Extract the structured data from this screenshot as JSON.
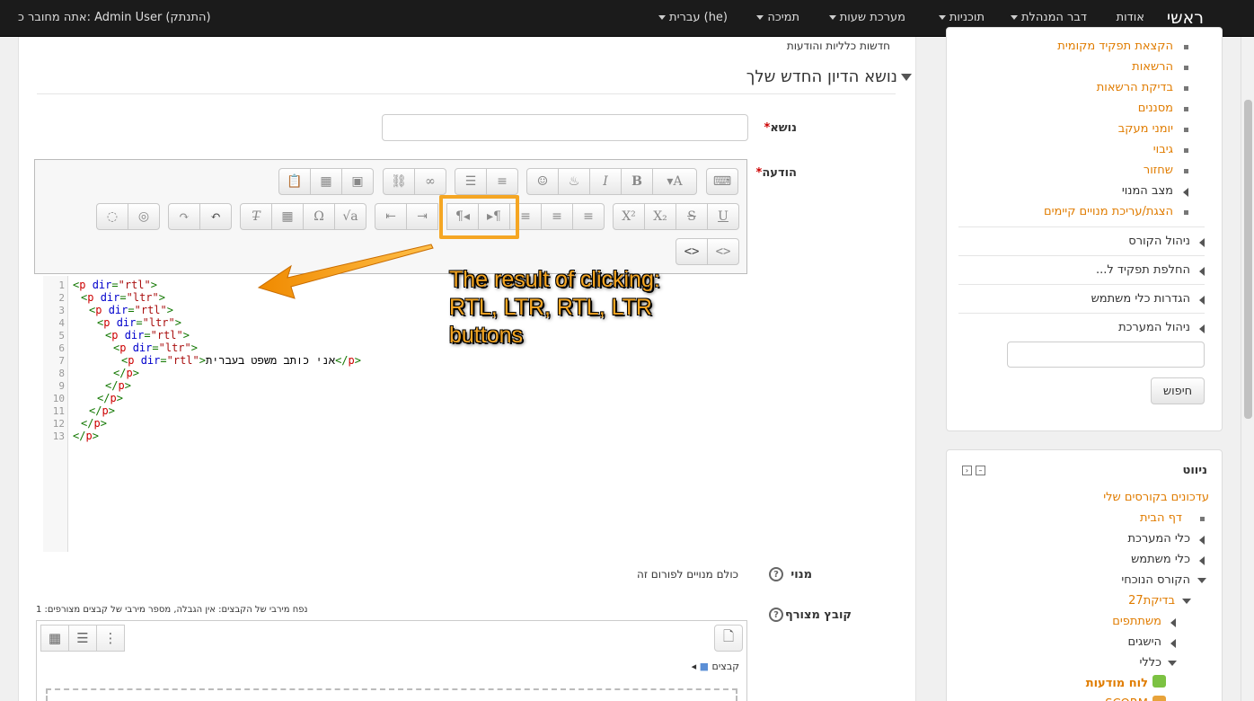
{
  "navbar": {
    "brand": "ראשי",
    "items": [
      "אודות",
      "דבר המנהלת",
      "תוכניות",
      "מערכת שעות",
      "תמיכה",
      "עברית ‎(he)‎"
    ],
    "login_text": "אתה מחובר כ: Admin User (התנתק)"
  },
  "breadcrumb": "חדשות כלליות והודעות",
  "form": {
    "legend": "נושא הדיון החדש שלך",
    "subject_label": "נושא",
    "message_label": "הודעה",
    "required_mark": "*",
    "subscription_label": "מנוי",
    "subscription_value": "כולם מנויים לפורום זה",
    "attachment_label": "קובץ מצורף",
    "file_limits": "נפח מירבי של הקבצים: אין הגבלה, מספר מירבי של קבצים מצורפים: 1",
    "files_folder": "קבצים"
  },
  "editor": {
    "code_lines": [
      {
        "indent": 0,
        "dir": "rtl",
        "text": "",
        "close": false
      },
      {
        "indent": 1,
        "dir": "ltr",
        "text": "",
        "close": false
      },
      {
        "indent": 2,
        "dir": "rtl",
        "text": "",
        "close": false
      },
      {
        "indent": 3,
        "dir": "ltr",
        "text": "",
        "close": false
      },
      {
        "indent": 4,
        "dir": "rtl",
        "text": "",
        "close": false
      },
      {
        "indent": 5,
        "dir": "ltr",
        "text": "",
        "close": false
      },
      {
        "indent": 6,
        "dir": "rtl",
        "text": "אני כותב משפט בעברית",
        "close": true
      },
      {
        "indent": 5,
        "closing": true
      },
      {
        "indent": 4,
        "closing": true
      },
      {
        "indent": 3,
        "closing": true
      },
      {
        "indent": 2,
        "closing": true
      },
      {
        "indent": 1,
        "closing": true
      },
      {
        "indent": 0,
        "closing": true
      }
    ],
    "line_numbers": [
      "1",
      "2",
      "3",
      "4",
      "5",
      "6",
      "7",
      "8",
      "9",
      "10",
      "11",
      "12",
      "13"
    ]
  },
  "annotation": {
    "line1": "The result of clicking:",
    "line2": "RTL, LTR, RTL, LTR",
    "line3": "buttons",
    "color": "#f5a623"
  },
  "sidebar": {
    "admin_items": [
      {
        "label": "הקצאת תפקיד מקומית",
        "type": "link"
      },
      {
        "label": "הרשאות",
        "type": "link"
      },
      {
        "label": "בדיקת הרשאות",
        "type": "link"
      },
      {
        "label": "מסננים",
        "type": "link"
      },
      {
        "label": "יומני מעקב",
        "type": "link"
      },
      {
        "label": "גיבוי",
        "type": "link"
      },
      {
        "label": "שחזור",
        "type": "link"
      },
      {
        "label": "מצב המנוי",
        "type": "branch"
      },
      {
        "label": "הצגת/עריכת מנויים קיימים",
        "type": "link"
      }
    ],
    "sections": [
      "ניהול הקורס",
      "החלפת תפקיד ל...",
      "הגדרות כלי משתמש",
      "ניהול המערכת"
    ],
    "search_button": "חיפוש",
    "nav_title": "ניווט",
    "nav_items": [
      {
        "label": "עדכונים בקורסים שלי"
      },
      {
        "label": "דף הבית"
      },
      {
        "label": "כלי המערכת"
      },
      {
        "label": "כלי משתמש"
      },
      {
        "label": "הקורס הנוכחי"
      },
      {
        "label": "בדיקת27"
      },
      {
        "label": "משתתפים"
      },
      {
        "label": "הישגים"
      },
      {
        "label": "כללי"
      },
      {
        "label": "לוח מודעות"
      },
      {
        "label": "SCORM"
      }
    ],
    "link_color": "#e07c00"
  }
}
